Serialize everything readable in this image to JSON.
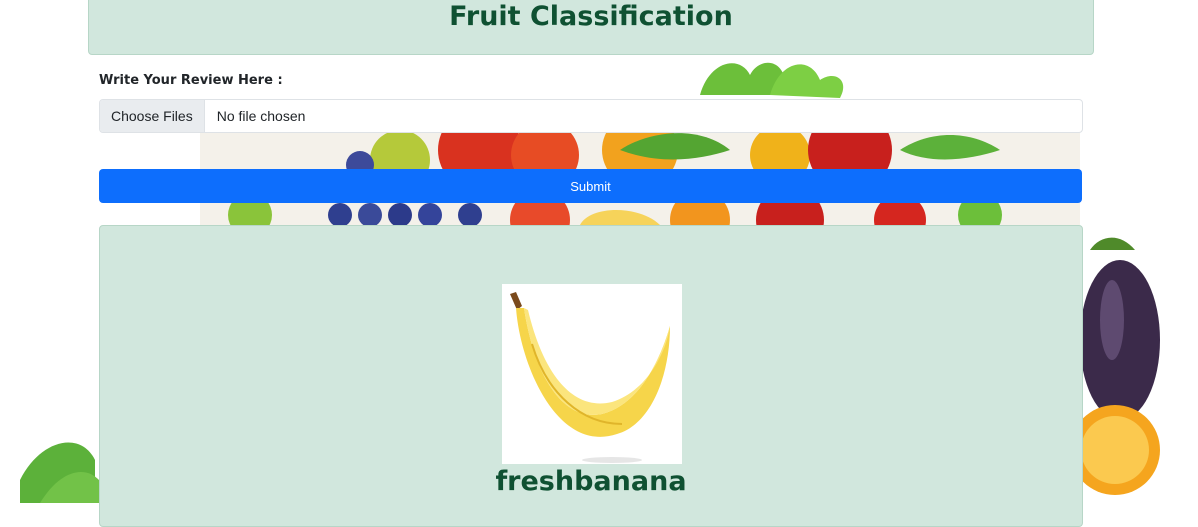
{
  "header": {
    "title": "Fruit Classification"
  },
  "form": {
    "label": "Write Your Review Here :",
    "file_button_label": "Choose Files",
    "file_status": "No file chosen",
    "submit_label": "Submit"
  },
  "result": {
    "image_icon": "banana-image",
    "prediction": "freshbanana"
  },
  "colors": {
    "card_bg": "#d1e7dd",
    "heading": "#0f5132",
    "primary": "#0d6efd"
  }
}
